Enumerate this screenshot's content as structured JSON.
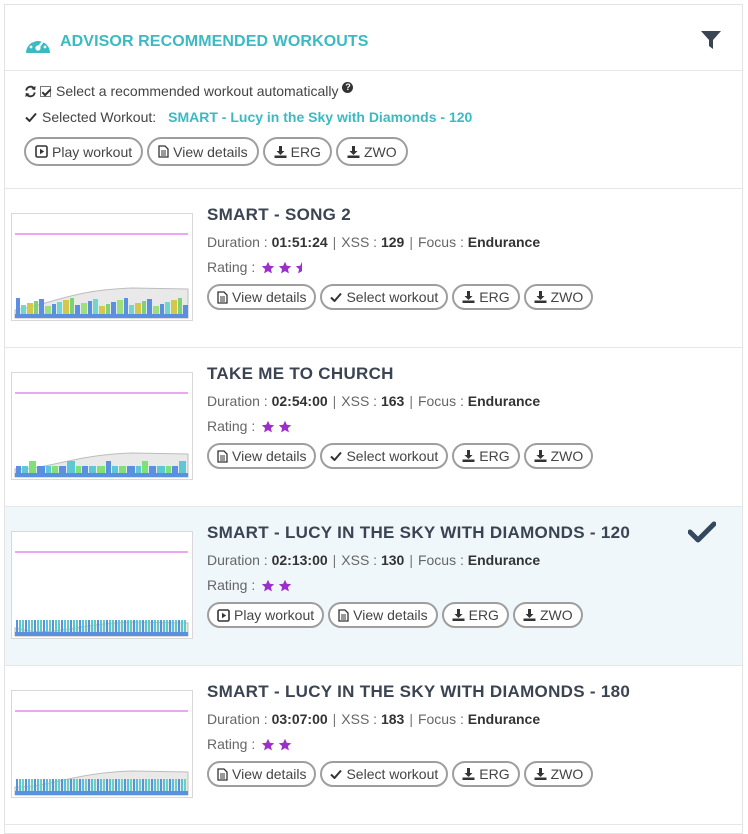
{
  "header": {
    "title": "ADVISOR RECOMMENDED WORKOUTS",
    "icon": "gauge-icon",
    "accent": "#3bbac2"
  },
  "controls": {
    "auto_select_label": "Select a recommended workout automatically",
    "auto_select_checked": true,
    "help_glyph": "?",
    "selected_label": "Selected Workout:",
    "selected_name": "SMART - Lucy in the Sky with Diamonds - 120",
    "buttons": {
      "play": "Play workout",
      "details": "View details",
      "erg": "ERG",
      "zwo": "ZWO"
    }
  },
  "labels": {
    "duration": "Duration :",
    "xss": "XSS :",
    "focus": "Focus :",
    "rating": "Rating :",
    "sep": "|",
    "view_details": "View details",
    "select_workout": "Select workout",
    "play_workout": "Play workout",
    "erg": "ERG",
    "zwo": "ZWO"
  },
  "workouts": [
    {
      "title": "SMART - SONG 2",
      "duration": "01:51:24",
      "xss": "129",
      "focus": "Endurance",
      "rating": 2.5,
      "selected": false
    },
    {
      "title": "TAKE ME TO CHURCH",
      "duration": "02:54:00",
      "xss": "163",
      "focus": "Endurance",
      "rating": 2,
      "selected": false
    },
    {
      "title": "SMART - LUCY IN THE SKY WITH DIAMONDS - 120",
      "duration": "02:13:00",
      "xss": "130",
      "focus": "Endurance",
      "rating": 2,
      "selected": true
    },
    {
      "title": "SMART - LUCY IN THE SKY WITH DIAMONDS - 180",
      "duration": "03:07:00",
      "xss": "183",
      "focus": "Endurance",
      "rating": 2,
      "selected": false
    }
  ],
  "colors": {
    "star": "#9b2fc9",
    "selected_bg": "#f0f7fa",
    "check": "#34495e"
  }
}
